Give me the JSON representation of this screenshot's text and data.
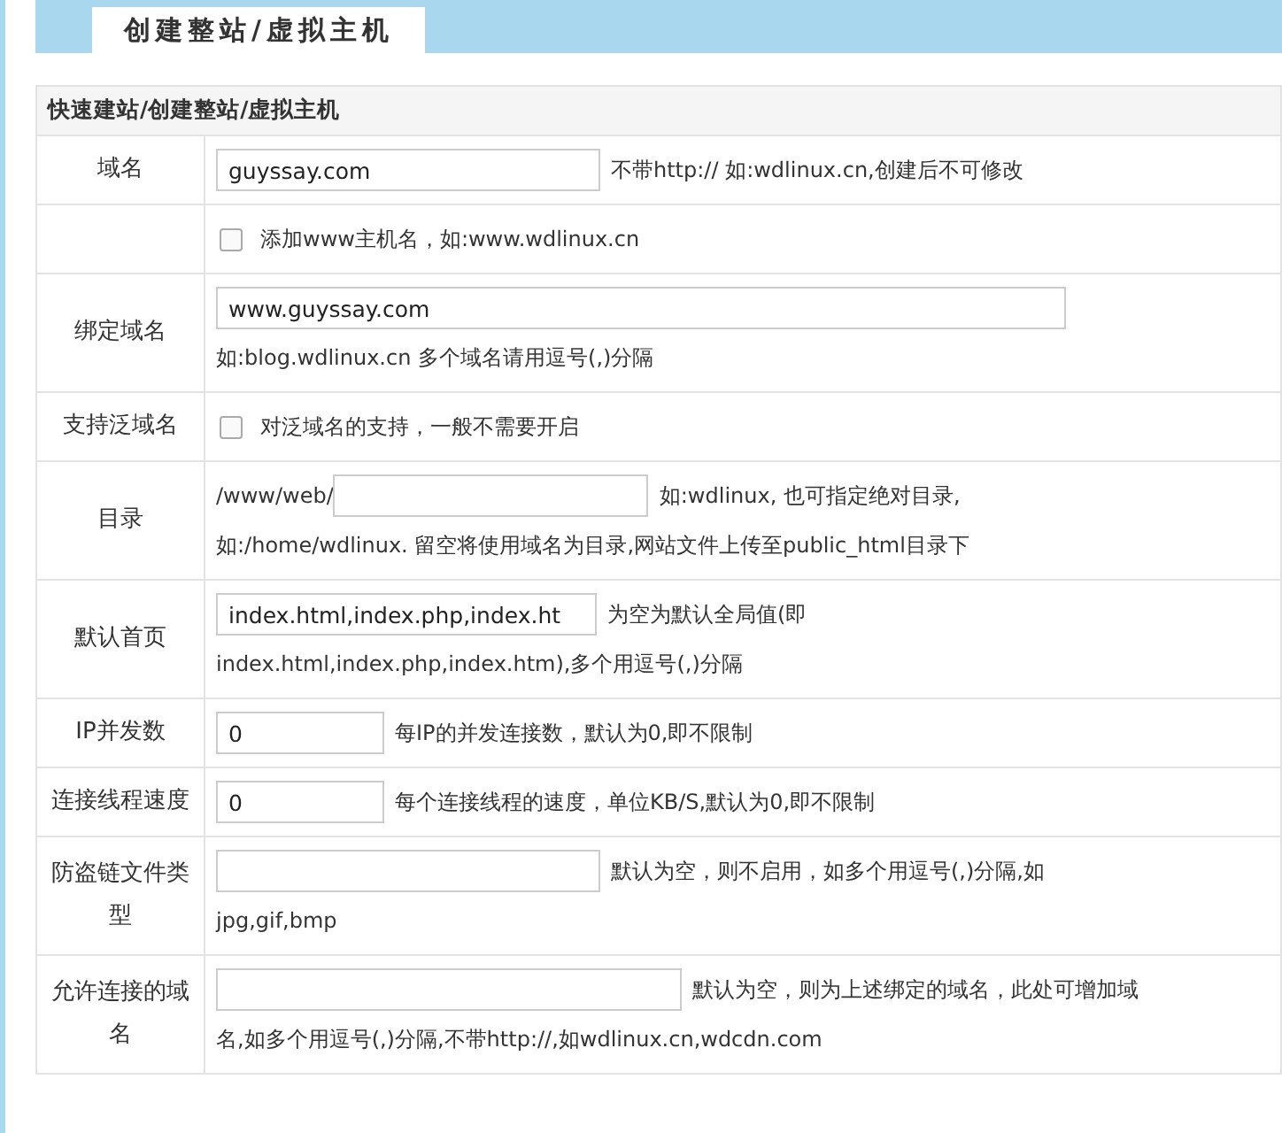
{
  "tab": {
    "label": "创建整站/虚拟主机",
    "selected": true
  },
  "table": {
    "caption": "快速建站/创建整站/虚拟主机",
    "rows": [
      {
        "kind": "inline",
        "label": "域名",
        "input": {
          "value": "guyssay.com"
        },
        "hint": [
          "不带http:// 如:wdlinux.cn,创建后不可修改"
        ]
      },
      {
        "kind": "inline",
        "label": "",
        "checkbox": {
          "checked": false
        },
        "hint": [
          "添加www主机名，如:www.wdlinux.cn"
        ]
      },
      {
        "kind": "stacked",
        "label": "绑定域名",
        "input": {
          "value": "www.guyssay.com"
        },
        "hint": [
          "如:blog.wdlinux.cn 多个域名请用逗号(,)分隔"
        ]
      },
      {
        "kind": "inline",
        "label": "支持泛域名",
        "checkbox": {
          "checked": false
        },
        "hint": [
          "对泛域名的支持，一般不需要开启"
        ]
      },
      {
        "kind": "inline",
        "label": "目录",
        "prefix": "/www/web/",
        "input": {},
        "hint": [
          "如:wdlinux, 也可指定绝对目录,",
          "如:/home/wdlinux. 留空将使用域名为目录,网站文件上传至public_html目录下"
        ]
      },
      {
        "kind": "inline",
        "label": "默认首页",
        "input": {
          "value": "index.html,index.php,index.ht"
        },
        "hint": [
          "为空为默认全局值(即",
          "index.html,index.php,index.htm),多个用逗号(,)分隔"
        ]
      },
      {
        "kind": "inline",
        "label": "IP并发数",
        "input": {
          "value": "0"
        },
        "hint": [
          "每IP的并发连接数，默认为0,即不限制"
        ]
      },
      {
        "kind": "inline",
        "label": "连接线程速度",
        "input": {
          "value": "0"
        },
        "hint": [
          "每个连接线程的速度，单位KB/S,默认为0,即不限制"
        ]
      },
      {
        "kind": "inline",
        "label": "防盗链文件类型",
        "input": {},
        "hint": [
          "默认为空，则不启用，如多个用逗号(,)分隔,如",
          "jpg,gif,bmp"
        ]
      },
      {
        "kind": "inline",
        "label": "允许连接的域名",
        "input": {},
        "hint": [
          "默认为空，则为上述绑定的域名，此处可增加域",
          "名,如多个用逗号(,)分隔,不带http://,如wdlinux.cn,wdcdn.com"
        ]
      }
    ]
  }
}
